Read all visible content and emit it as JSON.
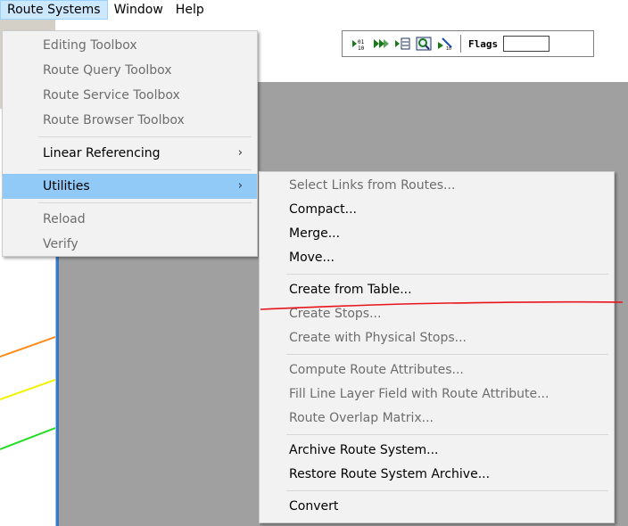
{
  "menubar": {
    "items": [
      {
        "label": "Route Systems"
      },
      {
        "label": "Window"
      },
      {
        "label": "Help"
      }
    ]
  },
  "toolbar": {
    "flags_label": "Flags",
    "flags_value": ""
  },
  "route_systems_menu": {
    "items": [
      {
        "label": "Editing Toolbox",
        "enabled": false
      },
      {
        "label": "Route Query Toolbox",
        "enabled": false
      },
      {
        "label": "Route Service Toolbox",
        "enabled": false
      },
      {
        "label": "Route Browser Toolbox",
        "enabled": false
      },
      {
        "label": "Linear Referencing",
        "enabled": true,
        "submenu": true
      },
      {
        "label": "Utilities",
        "enabled": true,
        "submenu": true,
        "selected": true
      },
      {
        "label": "Reload",
        "enabled": false
      },
      {
        "label": "Verify",
        "enabled": false
      }
    ]
  },
  "utilities_menu": {
    "items": [
      {
        "label": "Select Links from Routes...",
        "enabled": false
      },
      {
        "label": "Compact...",
        "enabled": true
      },
      {
        "label": "Merge...",
        "enabled": true
      },
      {
        "label": "Move...",
        "enabled": true
      },
      {
        "label": "Create from Table...",
        "enabled": true
      },
      {
        "label": "Create Stops...",
        "enabled": false
      },
      {
        "label": "Create with Physical Stops...",
        "enabled": false
      },
      {
        "label": "Compute Route Attributes...",
        "enabled": false
      },
      {
        "label": "Fill Line Layer Field with Route Attribute...",
        "enabled": false
      },
      {
        "label": "Route Overlap Matrix...",
        "enabled": false
      },
      {
        "label": "Archive Route System...",
        "enabled": true
      },
      {
        "label": "Restore Route System Archive...",
        "enabled": true
      },
      {
        "label": "Convert",
        "enabled": true
      }
    ]
  },
  "colors": {
    "selected_item": "#91c9f7",
    "menubar_active": "#cce8ff",
    "annotation_line": "#e8141c",
    "map_line_orange": "#ff8c1a",
    "map_line_yellow": "#f2f200",
    "map_line_green": "#22dd22"
  },
  "icons": [
    "route-tool-1-icon",
    "route-tool-2-icon",
    "route-tool-3-icon",
    "route-search-icon",
    "route-tool-5-icon"
  ]
}
